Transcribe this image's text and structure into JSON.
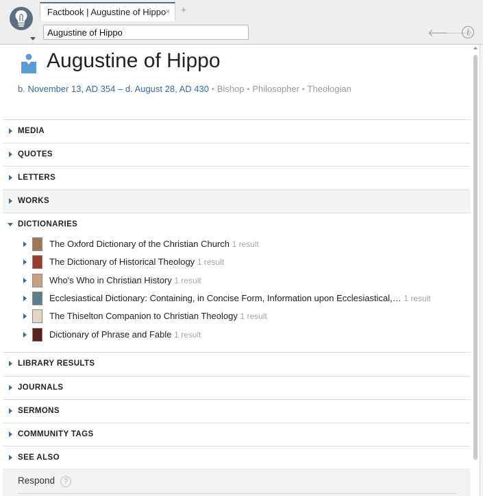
{
  "tab": {
    "title": "Factbook | Augustine of Hippo",
    "close_glyph": "×",
    "add_glyph": "+"
  },
  "search": {
    "value": "Augustine of Hippo"
  },
  "nav": {
    "back_icon": "arrow-left-icon",
    "forward_icon": "arrow-right-icon",
    "info_glyph": "i"
  },
  "person": {
    "name": "Augustine of Hippo",
    "dates": "b. November 13, AD 354 – d. August 28, AD 430",
    "separator": " • ",
    "roles": [
      "Bishop",
      "Philosopher",
      "Theologian"
    ]
  },
  "sections": {
    "media": "MEDIA",
    "quotes": "QUOTES",
    "letters": "LETTERS",
    "works": "WORKS",
    "dictionaries": "DICTIONARIES",
    "library_results": "LIBRARY RESULTS",
    "journals": "JOURNALS",
    "sermons": "SERMONS",
    "community_tags": "COMMUNITY TAGS",
    "see_also": "SEE ALSO"
  },
  "dictionaries": [
    {
      "title": "The Oxford Dictionary of the Christian Church",
      "count": "1 result",
      "cover_color": "#a07858"
    },
    {
      "title": "The Dictionary of Historical Theology",
      "count": "1 result",
      "cover_color": "#9a3b2c"
    },
    {
      "title": "Who's Who in Christian History",
      "count": "1 result",
      "cover_color": "#c9a080"
    },
    {
      "title": "Ecclesiastical Dictionary: Containing, in Concise Form, Information upon Ecclesiastical,…",
      "count": "1 result",
      "cover_color": "#5f7d8c"
    },
    {
      "title": "The Thiselton Companion to Christian Theology",
      "count": "1 result",
      "cover_color": "#e3d6c3"
    },
    {
      "title": "Dictionary of Phrase and Fable",
      "count": "1 result",
      "cover_color": "#5a1f1f"
    }
  ],
  "respond": {
    "label": "Respond",
    "help_glyph": "?"
  },
  "colors": {
    "accent": "#2f6da3",
    "muted": "#9a9a9a",
    "tab_border": "#4a6f9c"
  }
}
